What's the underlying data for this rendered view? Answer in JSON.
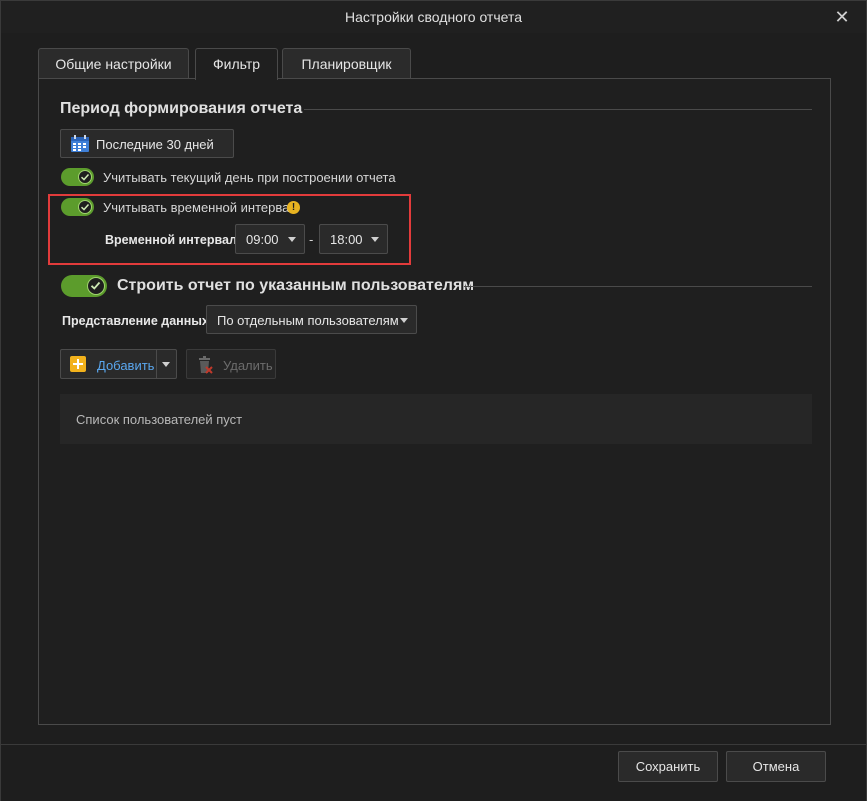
{
  "window": {
    "title": "Настройки сводного отчета"
  },
  "tabs": [
    {
      "label": "Общие настройки",
      "active": false
    },
    {
      "label": "Фильтр",
      "active": true
    },
    {
      "label": "Планировщик",
      "active": false
    }
  ],
  "period": {
    "title": "Период формирования отчета",
    "period_button": "Последние 30 дней",
    "include_today": {
      "label": "Учитывать текущий день при построении отчета",
      "on": true
    },
    "time_interval": {
      "label": "Учитывать временной интервал",
      "on": true,
      "range_label": "Временной интервал:",
      "from": "09:00",
      "separator": "-",
      "to": "18:00"
    }
  },
  "users_section": {
    "title": "Строить отчет по указанным пользователям",
    "on": true,
    "view_label": "Представление данных:",
    "view_value": "По отдельным пользователям",
    "add_button": "Добавить",
    "delete_button": "Удалить",
    "empty_list": "Список пользователей пуст"
  },
  "footer": {
    "save": "Сохранить",
    "cancel": "Отмена"
  },
  "colors": {
    "accent_green": "#5c9c2c",
    "highlight_red": "#e23b3b",
    "link_blue": "#5aa7ef",
    "warning_yellow": "#e8b321"
  }
}
